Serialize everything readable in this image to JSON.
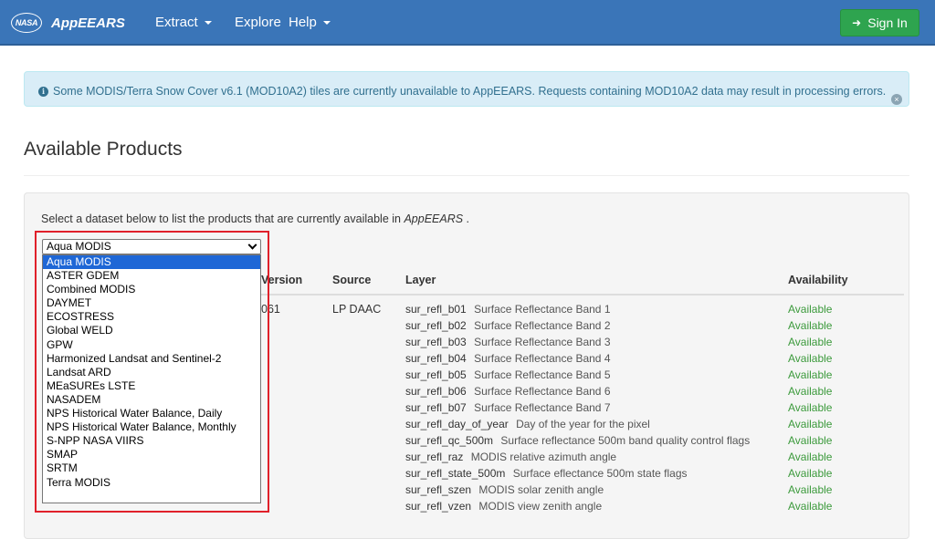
{
  "navbar": {
    "logo_text": "NASA",
    "brand": "AppEEARS",
    "items": [
      {
        "label": "Extract",
        "has_caret": true
      },
      {
        "label": "Explore",
        "has_caret": false
      },
      {
        "label": "Help",
        "has_caret": true
      }
    ],
    "signin_label": "Sign In",
    "signin_icon": "sign-in-icon"
  },
  "alert": {
    "icon": "info-circle-icon",
    "text": "Some MODIS/Terra Snow Cover v6.1 (MOD10A2) tiles are currently unavailable to AppEEARS. Requests containing MOD10A2 data may result in processing errors.",
    "close_icon": "close-circle-icon"
  },
  "page": {
    "title": "Available Products"
  },
  "intro": {
    "prefix": "Select a dataset below to list the products that are currently available in ",
    "app": "AppEEARS",
    "suffix": " ."
  },
  "dataset_select": {
    "selected": "Aqua MODIS",
    "options": [
      "Aqua MODIS",
      "ASTER GDEM",
      "Combined MODIS",
      "DAYMET",
      "ECOSTRESS",
      "Global WELD",
      "GPW",
      "Harmonized Landsat and Sentinel-2",
      "Landsat ARD",
      "MEaSUREs LSTE",
      "NASADEM",
      "NPS Historical Water Balance, Daily",
      "NPS Historical Water Balance, Monthly",
      "S-NPP NASA VIIRS",
      "SMAP",
      "SRTM",
      "Terra MODIS"
    ]
  },
  "table": {
    "headers": {
      "version": "Version",
      "source": "Source",
      "layer": "Layer",
      "availability": "Availability"
    },
    "row": {
      "version": "061",
      "source": "LP DAAC",
      "layers": [
        {
          "name": "sur_refl_b01",
          "desc": "Surface Reflectance Band 1",
          "status": "Available"
        },
        {
          "name": "sur_refl_b02",
          "desc": "Surface Reflectance Band 2",
          "status": "Available"
        },
        {
          "name": "sur_refl_b03",
          "desc": "Surface Reflectance Band 3",
          "status": "Available"
        },
        {
          "name": "sur_refl_b04",
          "desc": "Surface Reflectance Band 4",
          "status": "Available"
        },
        {
          "name": "sur_refl_b05",
          "desc": "Surface Reflectance Band 5",
          "status": "Available"
        },
        {
          "name": "sur_refl_b06",
          "desc": "Surface Reflectance Band 6",
          "status": "Available"
        },
        {
          "name": "sur_refl_b07",
          "desc": "Surface Reflectance Band 7",
          "status": "Available"
        },
        {
          "name": "sur_refl_day_of_year",
          "desc": "Day of the year for the pixel",
          "status": "Available"
        },
        {
          "name": "sur_refl_qc_500m",
          "desc": "Surface reflectance 500m band quality control flags",
          "status": "Available"
        },
        {
          "name": "sur_refl_raz",
          "desc": "MODIS relative azimuth angle",
          "status": "Available"
        },
        {
          "name": "sur_refl_state_500m",
          "desc": "Surface eflectance 500m state flags",
          "status": "Available"
        },
        {
          "name": "sur_refl_szen",
          "desc": "MODIS solar zenith angle",
          "status": "Available"
        },
        {
          "name": "sur_refl_vzen",
          "desc": "MODIS view zenith angle",
          "status": "Available"
        }
      ]
    }
  },
  "colors": {
    "navbar": "#3a75b8",
    "signin": "#2ea44f",
    "alert_bg": "#d9edf7",
    "alert_text": "#31708f",
    "available": "#3c9a3c",
    "highlight": "#e0202a",
    "selected_option": "#1e67d6"
  }
}
